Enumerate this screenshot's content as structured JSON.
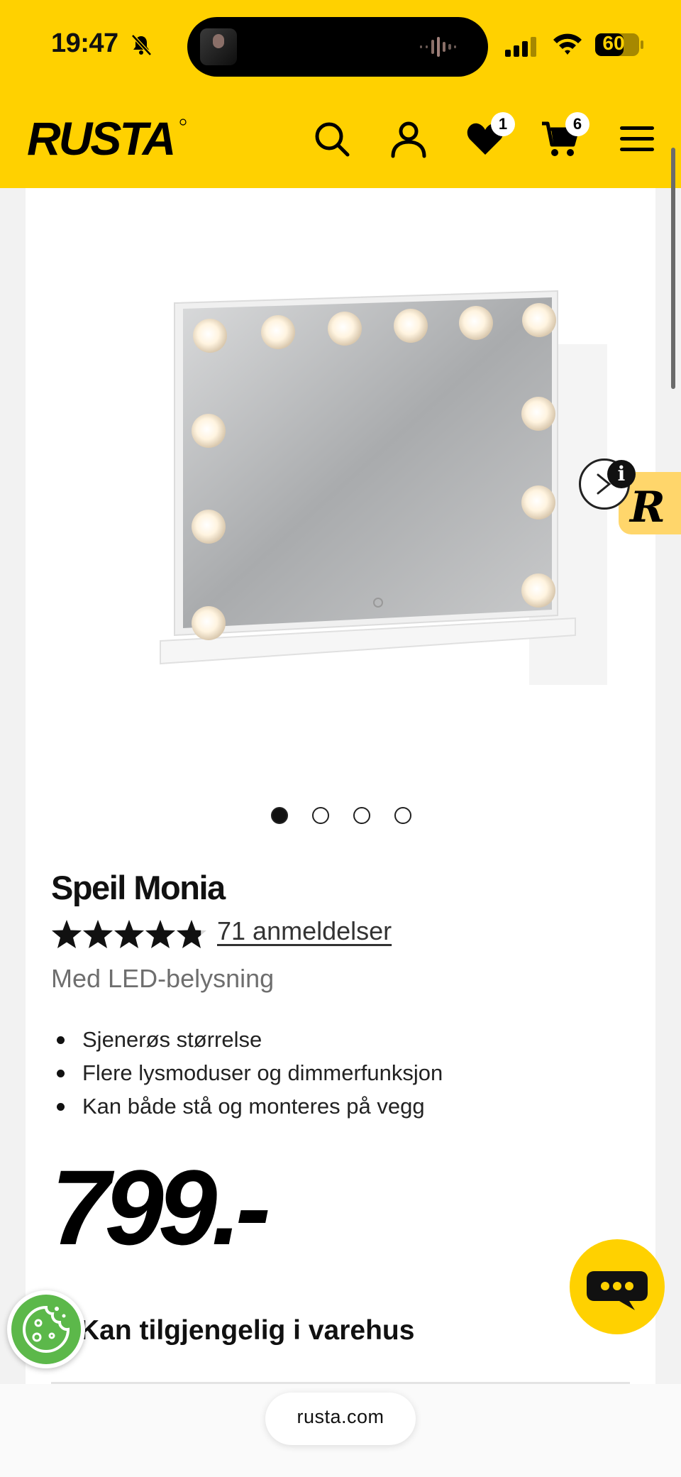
{
  "status_bar": {
    "time": "19:47",
    "battery": "60",
    "icons": [
      "bell-muted-icon",
      "signal-icon",
      "wifi-icon",
      "battery-icon"
    ]
  },
  "header": {
    "logo": "RUSTA",
    "icons": [
      "search-icon",
      "account-icon",
      "heart-icon",
      "cart-icon",
      "menu-icon"
    ],
    "wishlist_count": "1",
    "cart_count": "6",
    "background": "#ffd100"
  },
  "product": {
    "title": "Speil Monia",
    "rating": 4.8,
    "rating_max": 5,
    "reviews_label": "71 anmeldelser",
    "subtitle": "Med LED-belysning",
    "features": [
      "Sjenerøs størrelse",
      "Flere lysmoduser og dimmerfunksjon",
      "Kan både stå og monteres på vegg"
    ],
    "price": "799.-",
    "stock_text": "Kan tilgjengelig i varehus",
    "image_count": 4,
    "active_image": 1
  },
  "browser": {
    "url": "rusta.com"
  },
  "floating": {
    "chat_icon": "chat-bubble-icon",
    "cookie_icon": "cookie-icon",
    "promo_icon": "rusta-r-icon"
  }
}
